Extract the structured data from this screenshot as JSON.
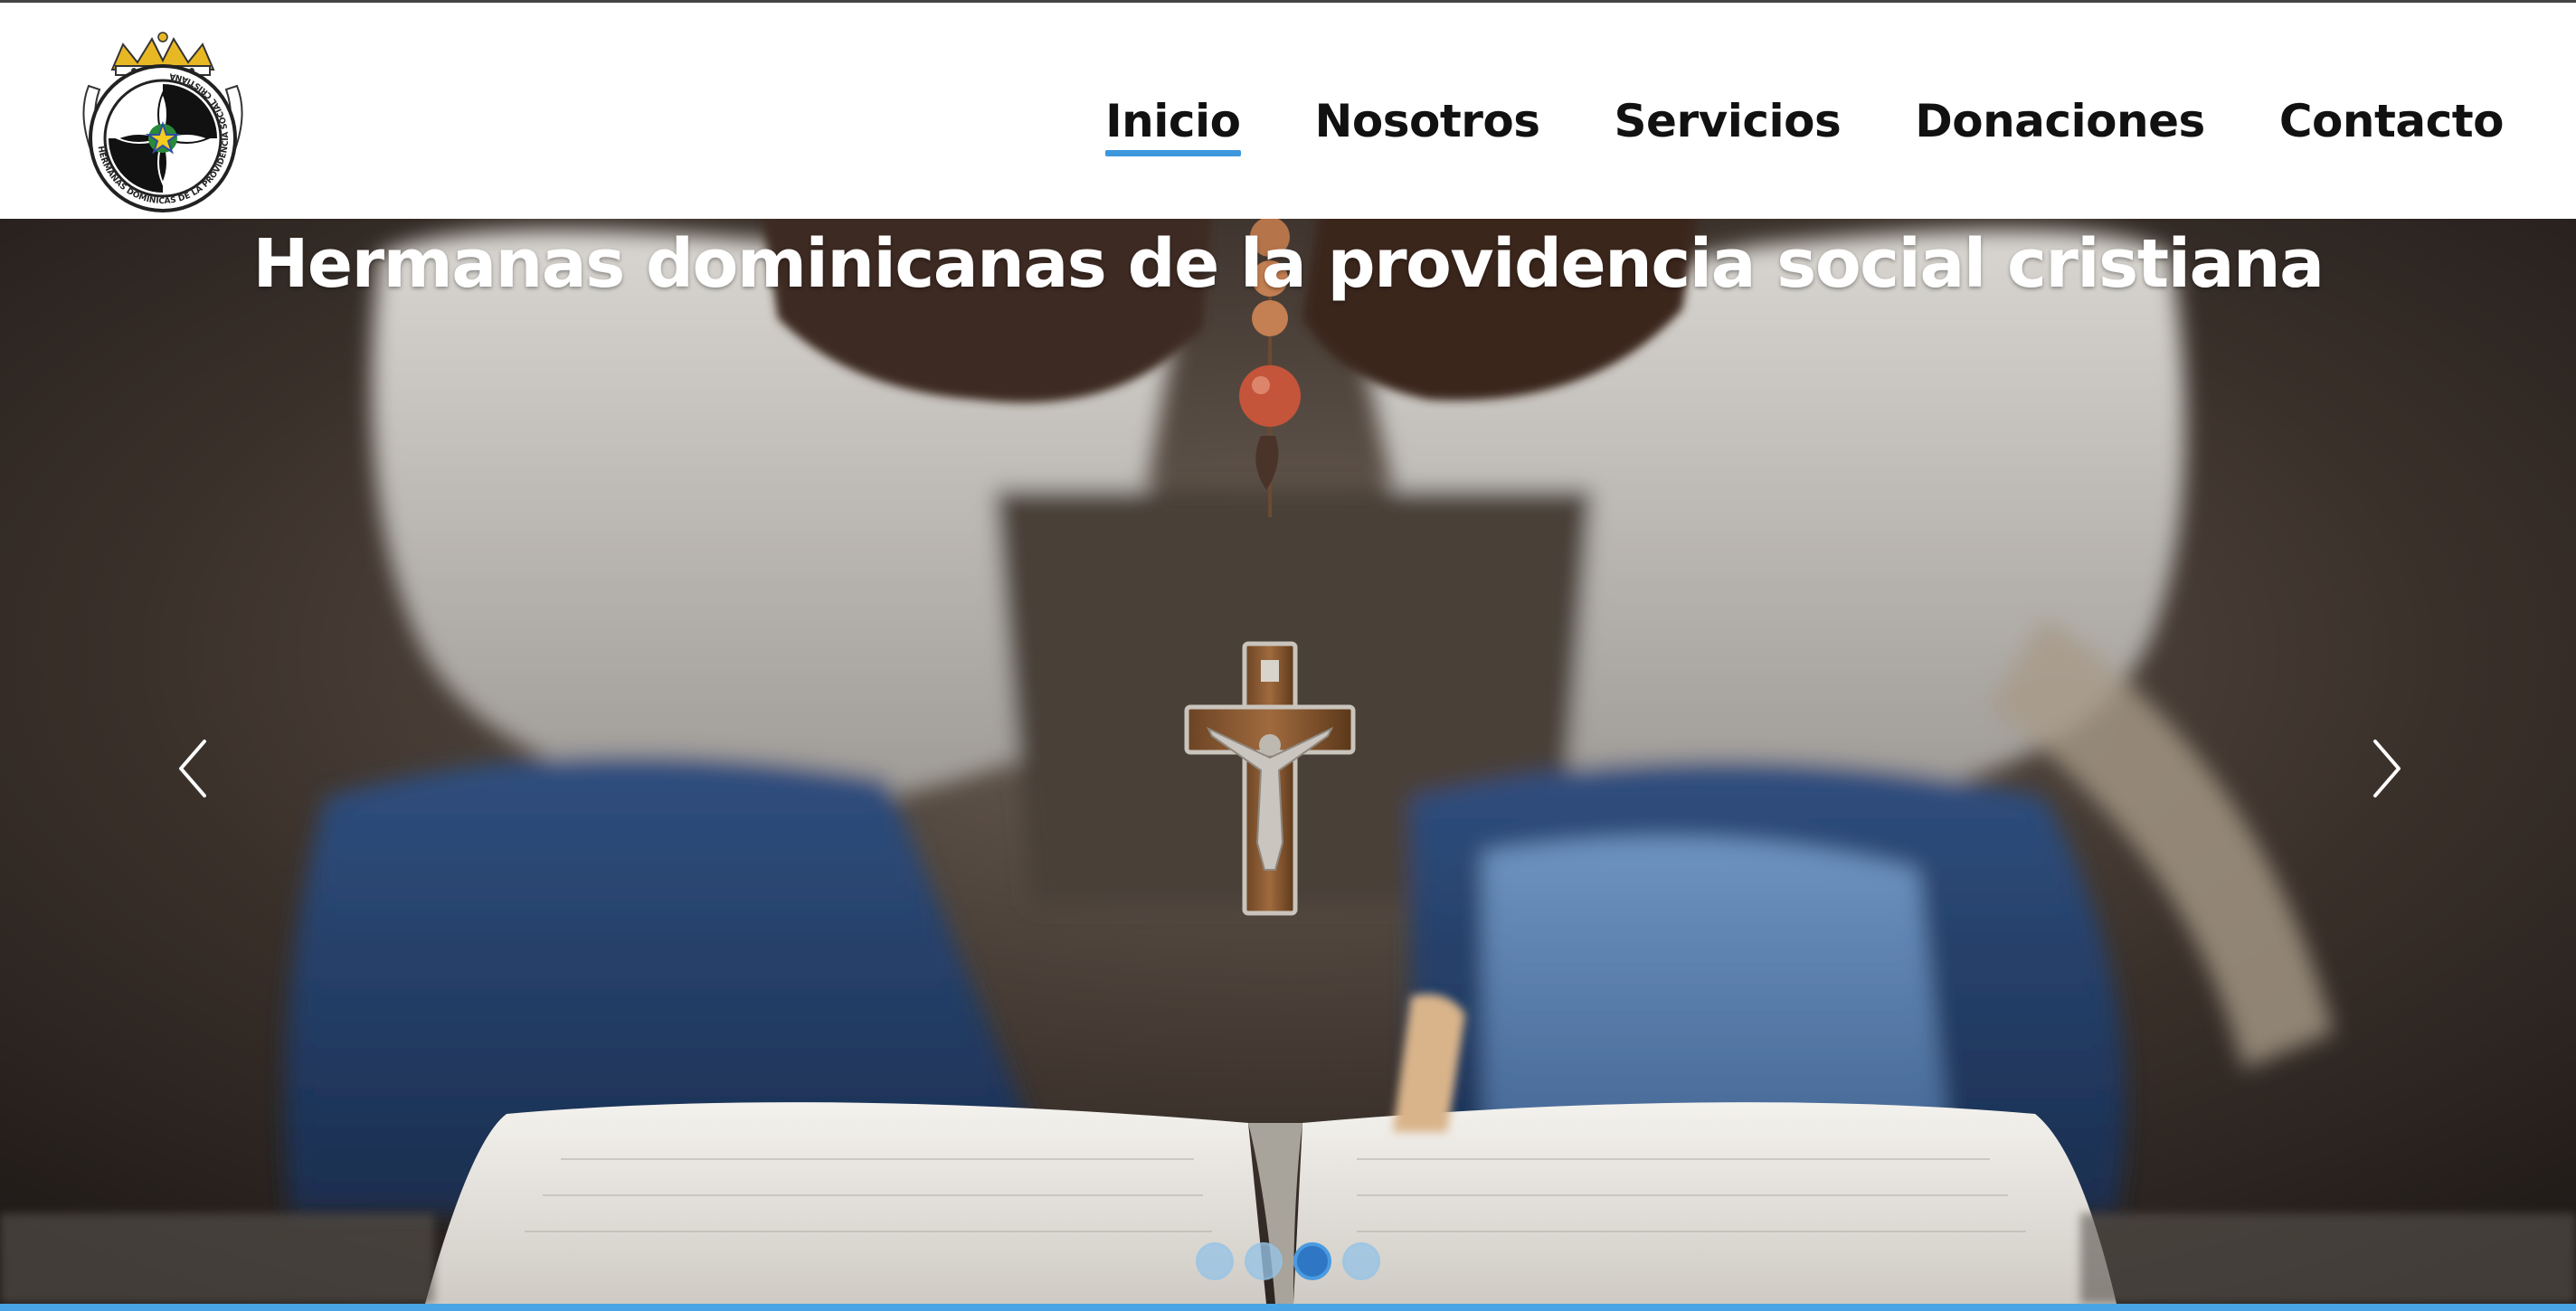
{
  "site": {
    "logo_icon": "crest-logo",
    "logo_text": "HERMANAS DOMINICAS DE LA PROVIDENCIA SOCIAL CRISTIANA"
  },
  "nav": {
    "items": [
      {
        "label": "Inicio",
        "active": true
      },
      {
        "label": "Nosotros",
        "active": false
      },
      {
        "label": "Servicios",
        "active": false
      },
      {
        "label": "Donaciones",
        "active": false
      },
      {
        "label": "Contacto",
        "active": false
      }
    ]
  },
  "hero": {
    "title": "Hermanas dominicanas de la providencia social cristiana",
    "prev_icon": "chevron-left-icon",
    "next_icon": "chevron-right-icon",
    "slides_total": 4,
    "active_slide": 3
  },
  "colors": {
    "accent": "#3d97dd",
    "nav_text": "#111111",
    "indicator_active": "#2f77c4",
    "indicator": "#96c3e6"
  }
}
